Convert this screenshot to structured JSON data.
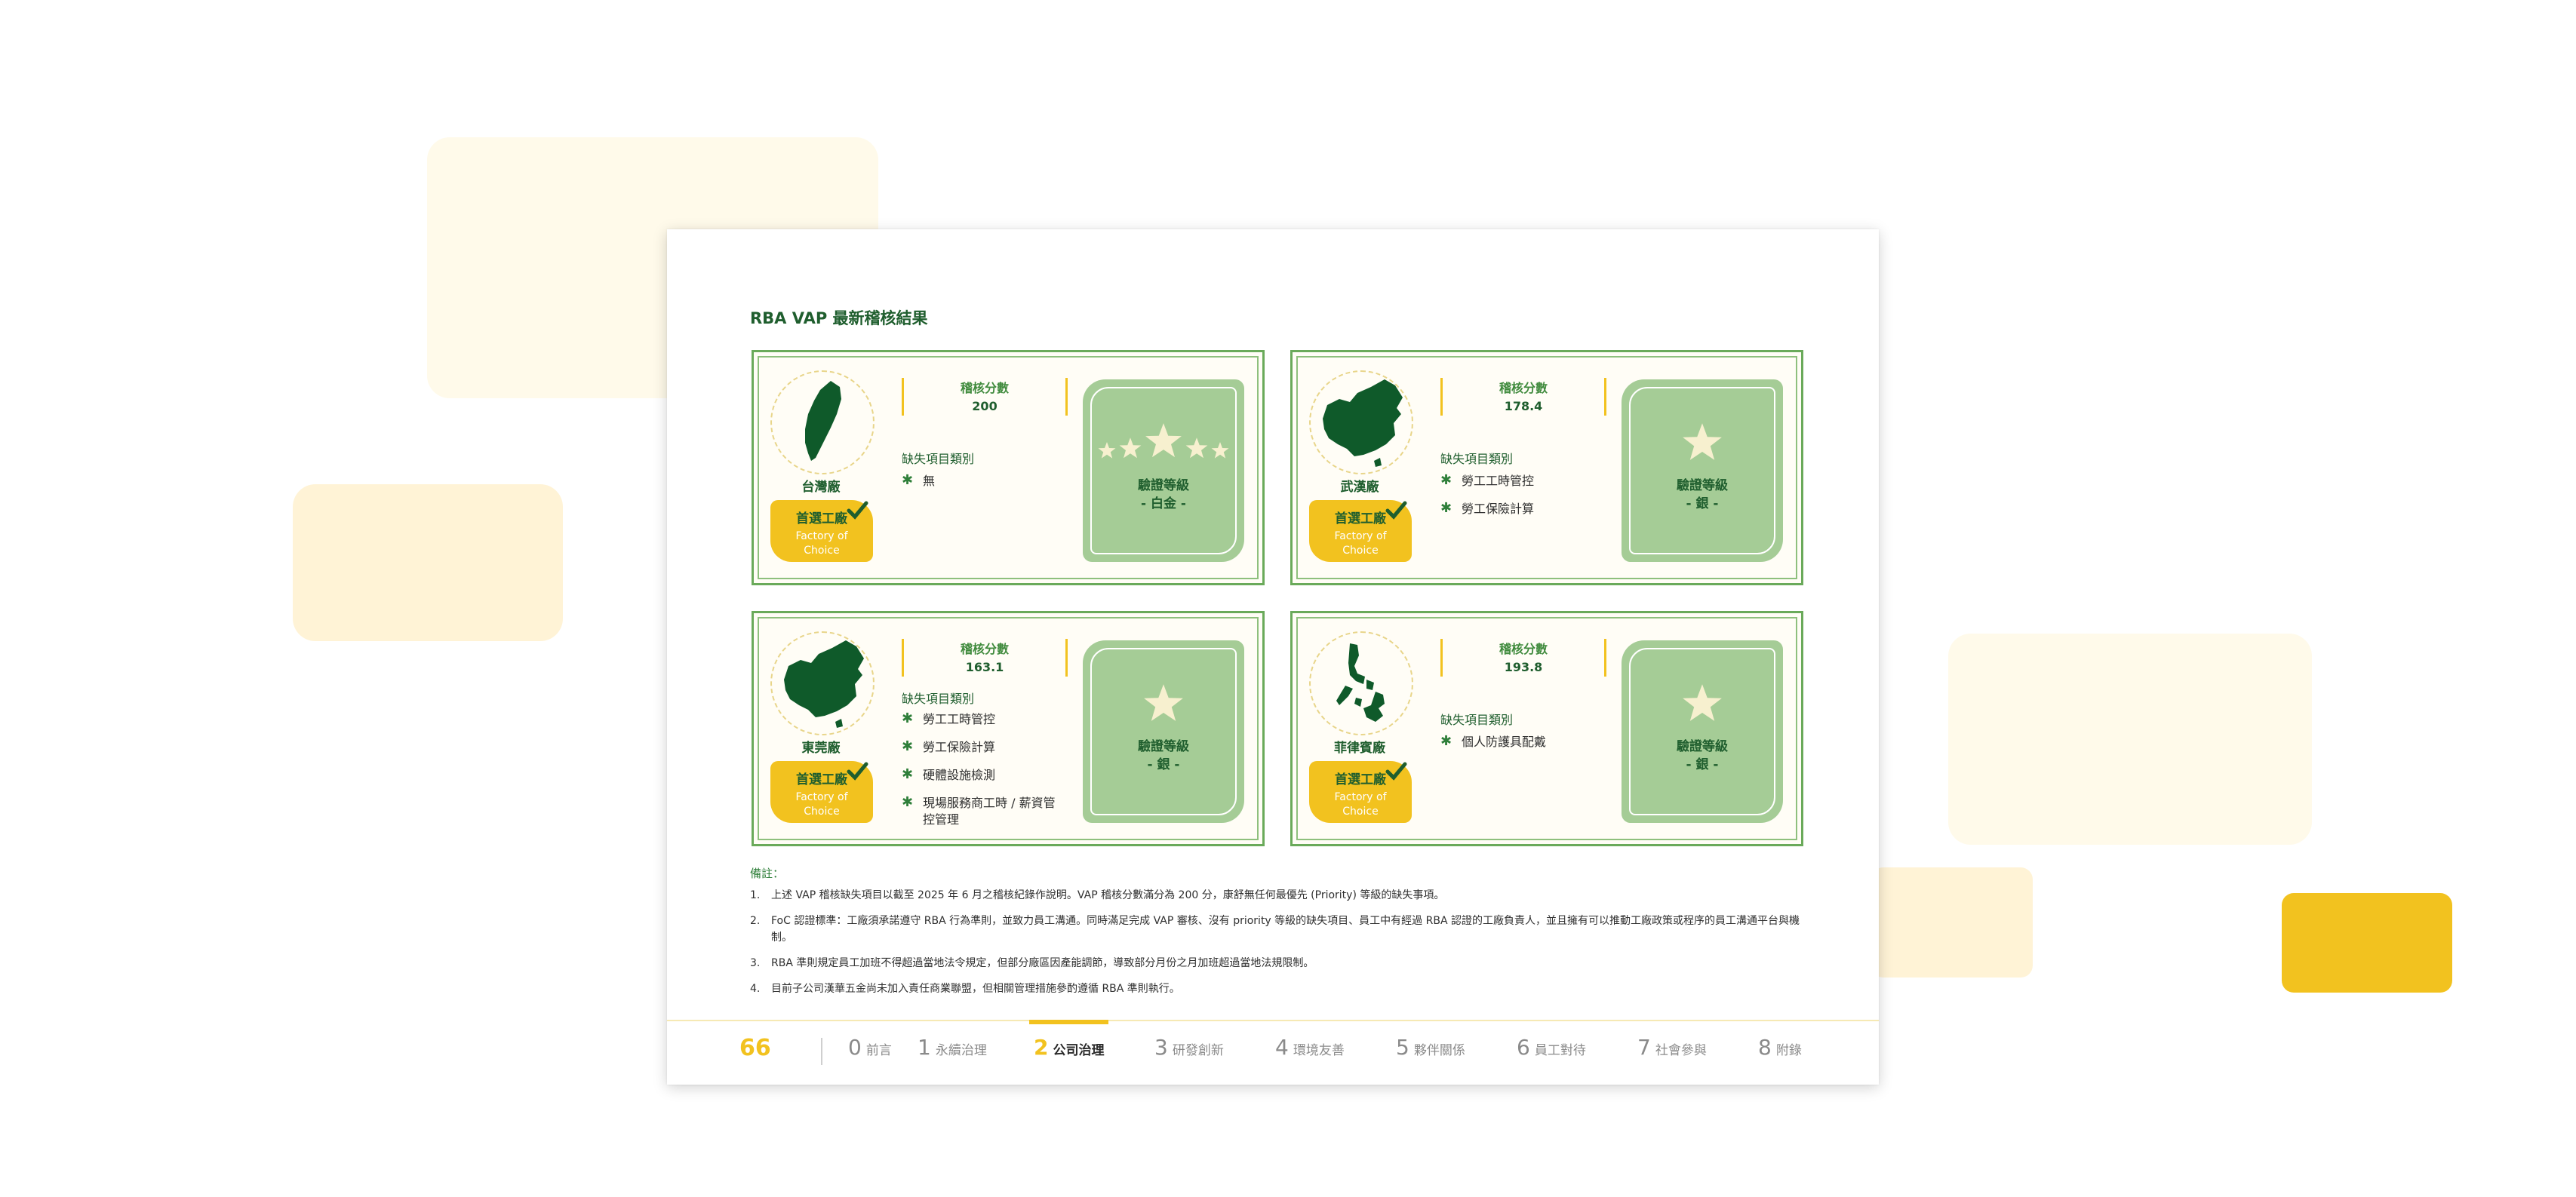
{
  "title": "RBA VAP 最新稽核結果",
  "cards": [
    {
      "factory": "台灣廠",
      "map_icon": "taiwan-map-icon",
      "foc_label": "首選工廠",
      "foc_sub": "Factory of Choice",
      "score_label": "稽核分數",
      "score": "200",
      "defect_title": "缺失項目類別",
      "defects": [
        "無"
      ],
      "cert_label": "驗證等級",
      "cert_level": "- 白金 -",
      "star_count": 5
    },
    {
      "factory": "武漢廠",
      "map_icon": "china-map-icon",
      "foc_label": "首選工廠",
      "foc_sub": "Factory of Choice",
      "score_label": "稽核分數",
      "score": "178.4",
      "defect_title": "缺失項目類別",
      "defects": [
        "勞工工時管控",
        "勞工保險計算"
      ],
      "cert_label": "驗證等級",
      "cert_level": "- 銀 -",
      "star_count": 1
    },
    {
      "factory": "東莞廠",
      "map_icon": "china-map-icon",
      "foc_label": "首選工廠",
      "foc_sub": "Factory of Choice",
      "score_label": "稽核分數",
      "score": "163.1",
      "defect_title": "缺失項目類別",
      "defects": [
        "勞工工時管控",
        "勞工保險計算",
        "硬體設施檢測",
        "現場服務商工時 / 薪資管控管理"
      ],
      "cert_label": "驗證等級",
      "cert_level": "- 銀 -",
      "star_count": 1
    },
    {
      "factory": "菲律賓廠",
      "map_icon": "philippines-map-icon",
      "foc_label": "首選工廠",
      "foc_sub": "Factory of Choice",
      "score_label": "稽核分數",
      "score": "193.8",
      "defect_title": "缺失項目類別",
      "defects": [
        "個人防護具配戴"
      ],
      "cert_label": "驗證等級",
      "cert_level": "- 銀 -",
      "star_count": 1
    }
  ],
  "notes": {
    "title": "備註：",
    "items": [
      {
        "num": "1.",
        "text": "上述 VAP 稽核缺失項目以截至 2025 年 6 月之稽核紀錄作說明。VAP 稽核分數滿分為 200 分，康舒無任何最優先 (Priority) 等級的缺失事項。"
      },
      {
        "num": "2.",
        "text": "FoC 認證標準：工廠須承諾遵守 RBA 行為準則，並致力員工溝通。同時滿足完成 VAP 審核、沒有 priority 等級的缺失項目、員工中有經過 RBA 認證的工廠負責人，並且擁有可以推動工廠政策或程序的員工溝通平台與機制。"
      },
      {
        "num": "3.",
        "text": "RBA 準則規定員工加班不得超過當地法令規定，但部分廠區因產能調節，導致部分月份之月加班超過當地法規限制。"
      },
      {
        "num": "4.",
        "text": "目前子公司漢華五金尚未加入責任商業聯盟，但相關管理措施參酌遵循 RBA 準則執行。"
      }
    ]
  },
  "footer": {
    "page_number": "66",
    "nav": [
      {
        "num": "0",
        "label": "前言",
        "active": false
      },
      {
        "num": "1",
        "label": "永續治理",
        "active": false
      },
      {
        "num": "2",
        "label": "公司治理",
        "active": true
      },
      {
        "num": "3",
        "label": "研發創新",
        "active": false
      },
      {
        "num": "4",
        "label": "環境友善",
        "active": false
      },
      {
        "num": "5",
        "label": "夥伴關係",
        "active": false
      },
      {
        "num": "6",
        "label": "員工對待",
        "active": false
      },
      {
        "num": "7",
        "label": "社會參與",
        "active": false
      },
      {
        "num": "8",
        "label": "附錄",
        "active": false
      }
    ]
  },
  "colors": {
    "dark_green": "#1f5e2e",
    "mid_green": "#6aaa5a",
    "cert_green": "#a5cc96",
    "yellow": "#f2c21f",
    "cream": "#fffdf6",
    "star": "#f7f0cf"
  }
}
